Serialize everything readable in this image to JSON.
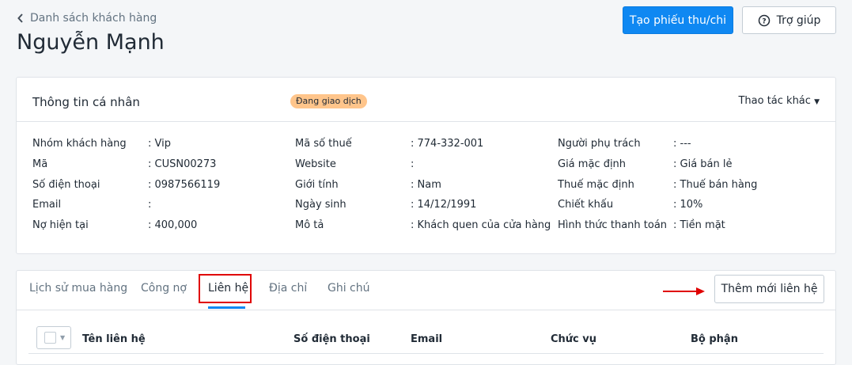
{
  "header": {
    "back_label": "Danh sách khách hàng",
    "title": "Nguyễn Mạnh",
    "create_button": "Tạo phiếu thu/chi",
    "help_button": "Trợ giúp"
  },
  "info": {
    "heading": "Thông tin cá nhân",
    "status": "Đang giao dịch",
    "more_actions": "Thao tác khác",
    "fields": [
      [
        {
          "label": "Nhóm khách hàng",
          "value": ": Vip"
        },
        {
          "label": "Mã",
          "value": ": CUSN00273"
        },
        {
          "label": "Số điện thoại",
          "value": ": 0987566119"
        },
        {
          "label": "Email",
          "value": ":"
        },
        {
          "label": "Nợ hiện tại",
          "value": ": 400,000"
        }
      ],
      [
        {
          "label": "Mã số thuế",
          "value": ": 774-332-001"
        },
        {
          "label": "Website",
          "value": ":"
        },
        {
          "label": "Giới tính",
          "value": ": Nam"
        },
        {
          "label": "Ngày sinh",
          "value": ": 14/12/1991"
        },
        {
          "label": "Mô tả",
          "value": ": Khách quen của cửa hàng"
        }
      ],
      [
        {
          "label": "Người phụ trách",
          "value": ": ---"
        },
        {
          "label": "Giá mặc định",
          "value": ": Giá bán lẻ"
        },
        {
          "label": "Thuế mặc định",
          "value": ": Thuế bán hàng"
        },
        {
          "label": "Chiết khấu",
          "value": ": 10%"
        },
        {
          "label": "Hình thức thanh toán",
          "value": ": Tiền mặt"
        }
      ]
    ]
  },
  "tabs": [
    "Lịch sử mua hàng",
    "Công nợ",
    "Liên hệ",
    "Địa chỉ",
    "Ghi chú"
  ],
  "active_tab": "Liên hệ",
  "add_contact_button": "Thêm mới liên hệ",
  "table": {
    "columns": [
      "Tên liên hệ",
      "Số điện thoại",
      "Email",
      "Chức vụ",
      "Bộ phận"
    ]
  },
  "colors": {
    "primary": "#0f88f2",
    "badge": "#ffc58b",
    "highlight": "#e00000"
  }
}
